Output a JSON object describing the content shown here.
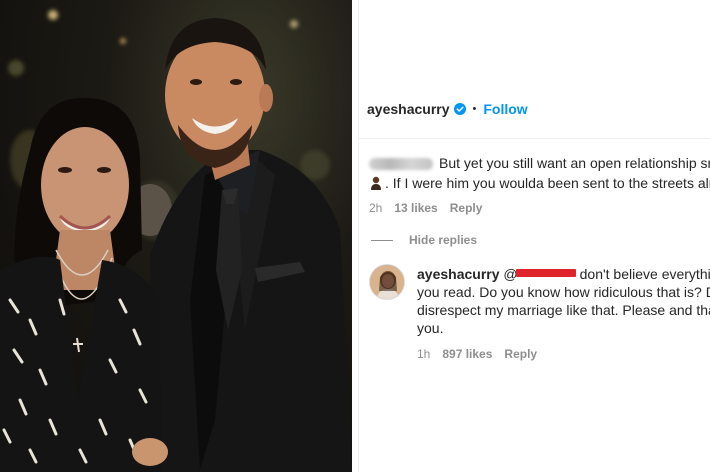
{
  "post": {
    "username": "ayeshacurry",
    "separator": "•",
    "follow_label": "Follow",
    "verified_icon": "verified-badge-icon",
    "accent_color": "#0095f6"
  },
  "comment1": {
    "line1": "But yet you still want an open relationship smh",
    "line2": ". If I were him you woulda been sent to the streets alread",
    "emoji_icon": "person-emoji-icon",
    "time": "2h",
    "likes": "13 likes",
    "reply_label": "Reply"
  },
  "hide_replies_label": "Hide replies",
  "reply": {
    "username": "ayeshacurry",
    "mention_prefix": "@",
    "line1_rest": "don't believe everything",
    "line2": "you read. Do you know how ridiculous that is? Dor",
    "line3": "disrespect my marriage like that. Please and thank",
    "line4": "you.",
    "time": "1h",
    "likes": "897 likes",
    "reply_label": "Reply",
    "redaction_color": "#e0242c"
  }
}
